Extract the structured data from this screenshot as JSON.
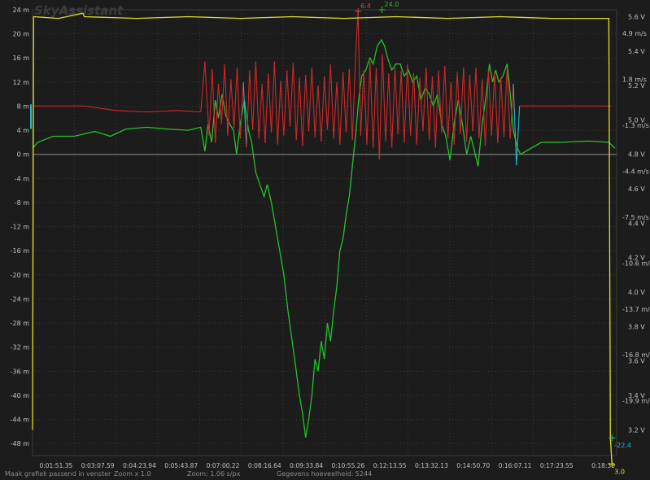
{
  "app": {
    "title": "SkyAssistant"
  },
  "status": {
    "fit": "Maak grafiek passend in venster",
    "zoom": "Zoom x 1.0",
    "zoom_rate": "Zoom: 1.06 s/px",
    "count": "Gegevens hoeveelheid: 5244"
  },
  "colors": {
    "background": "#1c1c1c",
    "grid": "#3a3a3a",
    "zero_line": "#8a8a8a",
    "altitude": "#22c22a",
    "vario_up": "#d02828",
    "vario_down": "#28b8c8",
    "voltage": "#e0e020",
    "axis_text": "#c0c0c0"
  },
  "chart_data": {
    "type": "line",
    "x_ticks": [
      "0:01:51.35",
      "0:03:07.59",
      "0:04:23.94",
      "0:05:43.87",
      "0:07:00.22",
      "0:08:16.64",
      "0:09:33.84",
      "0:10:55.26",
      "0:12:13.55",
      "0:13:32.13",
      "0:14:50.70",
      "0:16:07.11",
      "0:17:23.55",
      "0:18:39"
    ],
    "x_range_s": [
      0,
      1125
    ],
    "grid": true,
    "y_left": {
      "unit": "m",
      "ticks": [
        "24 m",
        "20 m",
        "16 m",
        "12 m",
        "8 m",
        "4 m",
        "0 m",
        "-4 m",
        "-8 m",
        "-12 m",
        "-16 m",
        "-20 m",
        "-24 m",
        "-28 m",
        "-32 m",
        "-36 m",
        "-40 m",
        "-44 m",
        "-48 m"
      ],
      "range": [
        -50,
        24
      ]
    },
    "y_right_vario": {
      "unit": "m/s",
      "ticks": [
        "4.9 m/s",
        "1.8 m/s",
        "-1.3 m/s",
        "-4.4 m/s",
        "-7.5 m/s",
        "-10.6 m/s",
        "-13.7 m/s",
        "-16.8 m/s",
        "-19.9 m/s"
      ],
      "range": [
        -23.6,
        6.5
      ]
    },
    "y_right_voltage": {
      "unit": "V",
      "ticks": [
        "5.6 V",
        "5.4 V",
        "5.2 V",
        "5.0 V",
        "4.8 V",
        "4.6 V",
        "4.4 V",
        "4.2 V",
        "4.0 V",
        "3.8 V",
        "3.6 V",
        "3.4 V",
        "3.2 V"
      ],
      "range": [
        3.05,
        5.64
      ]
    },
    "markers": [
      {
        "label": "6.4",
        "series": "vario",
        "time_s": 627,
        "value": 6.4,
        "color": "#e04040"
      },
      {
        "label": "24.0",
        "series": "altitude",
        "time_s": 673,
        "value": 24.0,
        "color": "#22c22a"
      },
      {
        "label": "-22.4",
        "series": "vario",
        "time_s": 1116,
        "value": -22.4,
        "color": "#28b8c8"
      },
      {
        "label": "3.0",
        "series": "voltage",
        "time_s": 1116,
        "value": 3.0,
        "color": "#e0e020"
      }
    ],
    "series": [
      {
        "key": "altitude",
        "color": "#22c22a",
        "unit": "m",
        "points": [
          [
            0,
            1
          ],
          [
            10,
            2
          ],
          [
            40,
            3
          ],
          [
            80,
            3
          ],
          [
            120,
            3.8
          ],
          [
            150,
            3
          ],
          [
            180,
            4.2
          ],
          [
            220,
            4.5
          ],
          [
            260,
            4.2
          ],
          [
            300,
            4
          ],
          [
            324,
            4.5
          ],
          [
            332,
            0.5
          ],
          [
            338,
            5
          ],
          [
            345,
            2
          ],
          [
            352,
            9
          ],
          [
            358,
            6
          ],
          [
            365,
            10
          ],
          [
            372,
            6.5
          ],
          [
            380,
            5
          ],
          [
            387,
            4
          ],
          [
            393,
            0
          ],
          [
            400,
            5
          ],
          [
            408,
            9
          ],
          [
            416,
            4
          ],
          [
            422,
            2
          ],
          [
            430,
            -3
          ],
          [
            438,
            -5
          ],
          [
            446,
            -7
          ],
          [
            452,
            -5
          ],
          [
            460,
            -8
          ],
          [
            468,
            -12
          ],
          [
            476,
            -16
          ],
          [
            484,
            -20
          ],
          [
            492,
            -26
          ],
          [
            500,
            -31
          ],
          [
            508,
            -36
          ],
          [
            514,
            -40
          ],
          [
            520,
            -43
          ],
          [
            526,
            -47
          ],
          [
            532,
            -44
          ],
          [
            538,
            -40
          ],
          [
            544,
            -34
          ],
          [
            550,
            -36
          ],
          [
            556,
            -31
          ],
          [
            562,
            -34
          ],
          [
            568,
            -28
          ],
          [
            574,
            -31
          ],
          [
            580,
            -26
          ],
          [
            586,
            -22
          ],
          [
            592,
            -16
          ],
          [
            598,
            -14
          ],
          [
            604,
            -10
          ],
          [
            610,
            -7
          ],
          [
            616,
            -2
          ],
          [
            622,
            3
          ],
          [
            628,
            9
          ],
          [
            634,
            13
          ],
          [
            642,
            14
          ],
          [
            650,
            16
          ],
          [
            656,
            15
          ],
          [
            664,
            18
          ],
          [
            672,
            19
          ],
          [
            678,
            18
          ],
          [
            684,
            16
          ],
          [
            692,
            14
          ],
          [
            700,
            15
          ],
          [
            708,
            15
          ],
          [
            716,
            13
          ],
          [
            724,
            14
          ],
          [
            732,
            12
          ],
          [
            740,
            13
          ],
          [
            748,
            9
          ],
          [
            756,
            11
          ],
          [
            764,
            10
          ],
          [
            772,
            8
          ],
          [
            780,
            10
          ],
          [
            788,
            5
          ],
          [
            796,
            3
          ],
          [
            804,
            -1
          ],
          [
            812,
            5
          ],
          [
            820,
            9
          ],
          [
            828,
            5
          ],
          [
            836,
            0
          ],
          [
            844,
            3
          ],
          [
            850,
            1
          ],
          [
            858,
            -2
          ],
          [
            866,
            5
          ],
          [
            874,
            10
          ],
          [
            880,
            15
          ],
          [
            886,
            12
          ],
          [
            892,
            14
          ],
          [
            898,
            12
          ],
          [
            906,
            13
          ],
          [
            914,
            15
          ],
          [
            918,
            12
          ],
          [
            926,
            4
          ],
          [
            934,
            1
          ],
          [
            940,
            0
          ],
          [
            950,
            0.5
          ],
          [
            980,
            2
          ],
          [
            1020,
            2
          ],
          [
            1070,
            2.2
          ],
          [
            1110,
            2
          ],
          [
            1122,
            1
          ]
        ]
      },
      {
        "key": "vario",
        "unit": "m/s",
        "color_up": "#d02828",
        "color_down": "#28b8c8",
        "points": [
          [
            0,
            0
          ],
          [
            40,
            0
          ],
          [
            100,
            0
          ],
          [
            160,
            -0.3
          ],
          [
            220,
            -0.4
          ],
          [
            280,
            -0.3
          ],
          [
            324,
            -0.4
          ],
          [
            332,
            3
          ],
          [
            340,
            -2
          ],
          [
            346,
            2.5
          ],
          [
            352,
            -2.5
          ],
          [
            358,
            1.5
          ],
          [
            364,
            -1.2
          ],
          [
            370,
            2.8
          ],
          [
            376,
            -2
          ],
          [
            382,
            1.8
          ],
          [
            388,
            -1.5
          ],
          [
            394,
            2.6
          ],
          [
            400,
            -2.2
          ],
          [
            406,
            1.6
          ],
          [
            412,
            -2.8
          ],
          [
            418,
            2.4
          ],
          [
            424,
            -1.6
          ],
          [
            430,
            3
          ],
          [
            436,
            -2.2
          ],
          [
            442,
            1.5
          ],
          [
            448,
            -2.5
          ],
          [
            454,
            2.2
          ],
          [
            460,
            -1.8
          ],
          [
            466,
            3
          ],
          [
            472,
            -2.6
          ],
          [
            478,
            1.7
          ],
          [
            484,
            -2
          ],
          [
            490,
            2.4
          ],
          [
            496,
            -1.4
          ],
          [
            502,
            2.9
          ],
          [
            508,
            -2.3
          ],
          [
            514,
            1.9
          ],
          [
            520,
            -2.7
          ],
          [
            526,
            2.1
          ],
          [
            532,
            -1.7
          ],
          [
            538,
            2.6
          ],
          [
            544,
            -2.1
          ],
          [
            550,
            1.4
          ],
          [
            556,
            -2.4
          ],
          [
            562,
            2
          ],
          [
            568,
            -1.6
          ],
          [
            574,
            2.8
          ],
          [
            580,
            -2.2
          ],
          [
            586,
            1.6
          ],
          [
            592,
            -2.6
          ],
          [
            598,
            2.3
          ],
          [
            604,
            -1.8
          ],
          [
            610,
            2.5
          ],
          [
            616,
            -2.3
          ],
          [
            622,
            3.2
          ],
          [
            627,
            6.4
          ],
          [
            632,
            -2
          ],
          [
            638,
            2.4
          ],
          [
            644,
            -2.6
          ],
          [
            650,
            3
          ],
          [
            656,
            -2.8
          ],
          [
            662,
            2.6
          ],
          [
            668,
            -3.6
          ],
          [
            674,
            3.5
          ],
          [
            680,
            -2.4
          ],
          [
            686,
            2.2
          ],
          [
            692,
            -2.8
          ],
          [
            698,
            2.6
          ],
          [
            704,
            -1.9
          ],
          [
            710,
            2.4
          ],
          [
            716,
            -2.5
          ],
          [
            722,
            2.8
          ],
          [
            728,
            -2
          ],
          [
            734,
            2.2
          ],
          [
            740,
            -2.6
          ],
          [
            746,
            1.9
          ],
          [
            752,
            -1.7
          ],
          [
            758,
            2.6
          ],
          [
            764,
            -2.3
          ],
          [
            770,
            2
          ],
          [
            776,
            -2.8
          ],
          [
            782,
            2.4
          ],
          [
            788,
            -1.8
          ],
          [
            794,
            2.7
          ],
          [
            800,
            -2.2
          ],
          [
            806,
            1.6
          ],
          [
            812,
            -2.6
          ],
          [
            818,
            2.3
          ],
          [
            824,
            -1.9
          ],
          [
            830,
            2.6
          ],
          [
            836,
            -2.4
          ],
          [
            842,
            2.1
          ],
          [
            848,
            -1.7
          ],
          [
            854,
            2.6
          ],
          [
            860,
            -2.2
          ],
          [
            866,
            1.8
          ],
          [
            872,
            -2.7
          ],
          [
            878,
            2.4
          ],
          [
            884,
            -2
          ],
          [
            890,
            2.3
          ],
          [
            896,
            -2.5
          ],
          [
            902,
            1.9
          ],
          [
            908,
            -2.1
          ],
          [
            914,
            2.6
          ],
          [
            920,
            -2.2
          ],
          [
            926,
            1.5
          ],
          [
            932,
            -4
          ],
          [
            938,
            0
          ],
          [
            980,
            0
          ],
          [
            1040,
            0
          ],
          [
            1100,
            0
          ],
          [
            1114,
            0
          ]
        ]
      },
      {
        "key": "voltage",
        "color": "#e0e020",
        "unit": "V",
        "points": [
          [
            0,
            3.2
          ],
          [
            2,
            5.6
          ],
          [
            50,
            5.59
          ],
          [
            97,
            5.62
          ],
          [
            100,
            5.6
          ],
          [
            200,
            5.59
          ],
          [
            300,
            5.6
          ],
          [
            400,
            5.59
          ],
          [
            500,
            5.6
          ],
          [
            600,
            5.59
          ],
          [
            700,
            5.6
          ],
          [
            800,
            5.59
          ],
          [
            900,
            5.6
          ],
          [
            1000,
            5.59
          ],
          [
            1110,
            5.59
          ],
          [
            1113,
            3.15
          ],
          [
            1116,
            3.0
          ]
        ]
      }
    ]
  }
}
